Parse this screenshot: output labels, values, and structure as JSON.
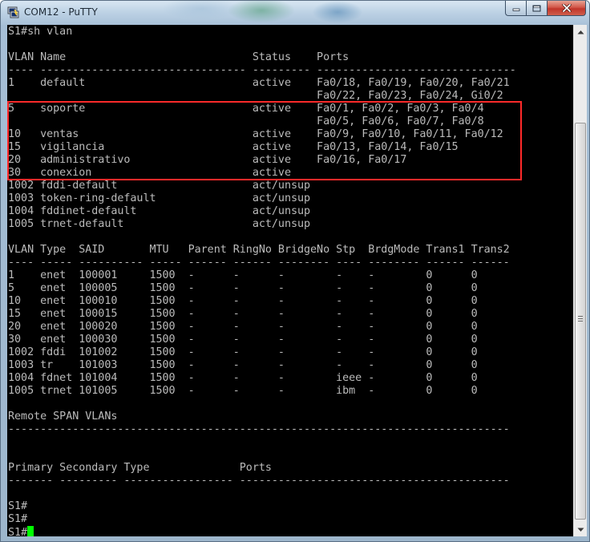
{
  "window": {
    "title": "COM12 - PuTTY",
    "icon": "putty-terminal-icon",
    "controls": {
      "minimize_icon": "minimize-icon",
      "maximize_icon": "maximize-icon",
      "close_icon": "close-icon"
    }
  },
  "colors": {
    "terminal_background": "#000000",
    "terminal_text": "#bbbbbb",
    "cursor": "#00ff00",
    "highlight_box": "#ff2a2a"
  },
  "terminal": {
    "lines": [
      "S1#sh vlan",
      "",
      "VLAN Name                             Status    Ports",
      "---- -------------------------------- --------- -------------------------------",
      "1    default                          active    Fa0/18, Fa0/19, Fa0/20, Fa0/21",
      "                                                Fa0/22, Fa0/23, Fa0/24, Gi0/2",
      "5    soporte                          active    Fa0/1, Fa0/2, Fa0/3, Fa0/4",
      "                                                Fa0/5, Fa0/6, Fa0/7, Fa0/8",
      "10   ventas                           active    Fa0/9, Fa0/10, Fa0/11, Fa0/12",
      "15   vigilancia                       active    Fa0/13, Fa0/14, Fa0/15",
      "20   administrativo                   active    Fa0/16, Fa0/17",
      "30   conexion                         active",
      "1002 fddi-default                     act/unsup",
      "1003 token-ring-default               act/unsup",
      "1004 fddinet-default                  act/unsup",
      "1005 trnet-default                    act/unsup",
      "",
      "VLAN Type  SAID       MTU   Parent RingNo BridgeNo Stp  BrdgMode Trans1 Trans2",
      "---- ----- ---------- ----- ------ ------ -------- ---- -------- ------ ------",
      "1    enet  100001     1500  -      -      -        -    -        0      0",
      "5    enet  100005     1500  -      -      -        -    -        0      0",
      "10   enet  100010     1500  -      -      -        -    -        0      0",
      "15   enet  100015     1500  -      -      -        -    -        0      0",
      "20   enet  100020     1500  -      -      -        -    -        0      0",
      "30   enet  100030     1500  -      -      -        -    -        0      0",
      "1002 fddi  101002     1500  -      -      -        -    -        0      0",
      "1003 tr    101003     1500  -      -      -        -    -        0      0",
      "1004 fdnet 101004     1500  -      -      -        ieee -        0      0",
      "1005 trnet 101005     1500  -      -      -        ibm  -        0      0",
      "",
      "Remote SPAN VLANs",
      "------------------------------------------------------------------------------",
      "",
      "",
      "Primary Secondary Type              Ports",
      "------- --------- ----------------- ------------------------------------------",
      "",
      "S1#",
      "S1#"
    ],
    "prompt": "S1#"
  },
  "scrollbar": {
    "up_icon": "scroll-up-arrow-icon",
    "down_icon": "scroll-down-arrow-icon",
    "grip_icon": "scroll-grip-icon"
  }
}
